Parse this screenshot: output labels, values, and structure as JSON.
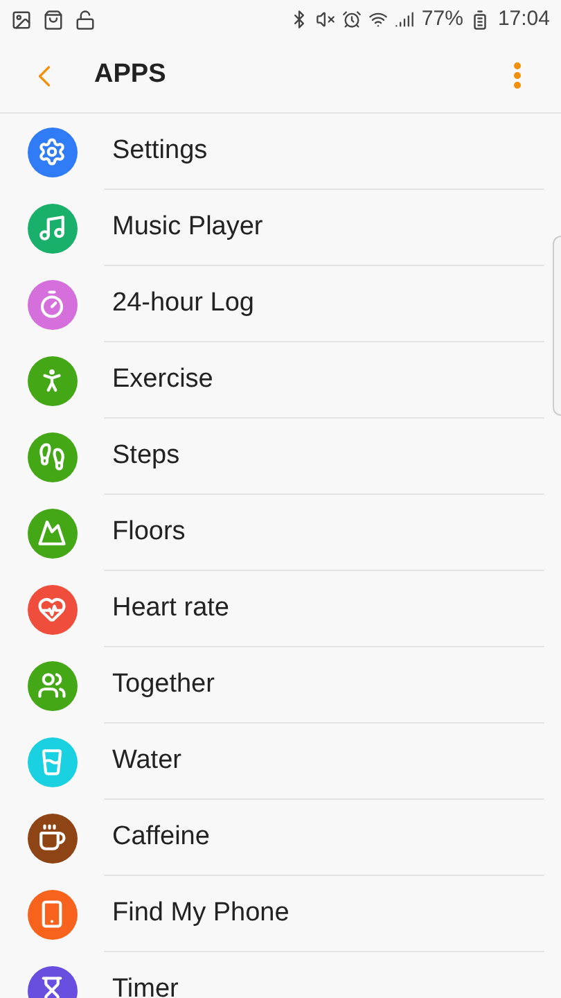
{
  "status_bar": {
    "battery": "77%",
    "time": "17:04"
  },
  "header": {
    "title": "APPS"
  },
  "apps": [
    {
      "label": "Settings",
      "kind": "gear",
      "color": "#2f7cf6"
    },
    {
      "label": "Music Player",
      "kind": "note",
      "color": "#18b06a"
    },
    {
      "label": "24-hour Log",
      "kind": "timer",
      "color": "#d46fdc"
    },
    {
      "label": "Exercise",
      "kind": "runner",
      "color": "#43a716"
    },
    {
      "label": "Steps",
      "kind": "shoe",
      "color": "#43a716"
    },
    {
      "label": "Floors",
      "kind": "mountain",
      "color": "#43a716"
    },
    {
      "label": "Heart rate",
      "kind": "heart",
      "color": "#ef4e3c"
    },
    {
      "label": "Together",
      "kind": "walkers",
      "color": "#43a716"
    },
    {
      "label": "Water",
      "kind": "glass",
      "color": "#19d1e0"
    },
    {
      "label": "Caffeine",
      "kind": "cup",
      "color": "#8e4414"
    },
    {
      "label": "Find My Phone",
      "kind": "phone",
      "color": "#f7631c"
    },
    {
      "label": "Timer",
      "kind": "hourglass",
      "color": "#6a4ee0"
    }
  ]
}
